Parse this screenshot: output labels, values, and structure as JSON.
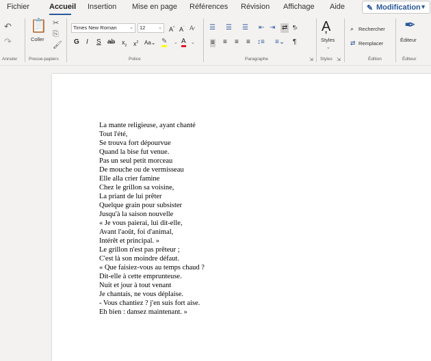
{
  "menu": {
    "tabs": [
      "Fichier",
      "Accueil",
      "Insertion",
      "Mise en page",
      "Références",
      "Révision",
      "Affichage",
      "Aide"
    ],
    "active_tab": "Accueil",
    "mode_button": "Modification"
  },
  "ribbon": {
    "groups": {
      "undo": "Annuler",
      "clipboard": "Presse-papiers",
      "font": "Police",
      "paragraph": "Paragraphe",
      "styles": "Styles",
      "edit": "Édition",
      "editor": "Éditeur"
    },
    "clipboard": {
      "paste_label": "Coller"
    },
    "font": {
      "name": "Times New Roman",
      "size": "12"
    },
    "styles_button": "Styles",
    "search": "Rechercher",
    "replace": "Remplacer",
    "editor_button": "Éditeur"
  },
  "document": {
    "lines": [
      "La mante religieuse, ayant chanté",
      "Tout l'été,",
      "Se trouva fort dépourvue",
      "Quand la bise fut venue.",
      "Pas un seul petit morceau",
      "De mouche ou de vermisseau",
      "Elle alla crier famine",
      "Chez le grillon sa voisine,",
      "La priant de lui prêter",
      "Quelque grain pour subsister",
      "Jusqu'à la saison nouvelle",
      "« Je vous paierai, lui dit-elle,",
      "Avant l'août, foi d'animal,",
      "Intérêt et principal. »",
      "Le grillon n'est pas prêteur ;",
      "C'est là son moindre défaut.",
      "« Que faisiez-vous au temps chaud ?",
      "Dit-elle à cette emprunteuse.",
      "Nuit et jour à tout venant",
      "Je chantais, ne vous déplaise.",
      "- Vous chantiez ? j'en suis fort aise.",
      "Eh bien : dansez maintenant. »"
    ]
  },
  "colors": {
    "accent": "#2b579a",
    "highlight": "#ffff00",
    "font_color": "#e81123"
  }
}
